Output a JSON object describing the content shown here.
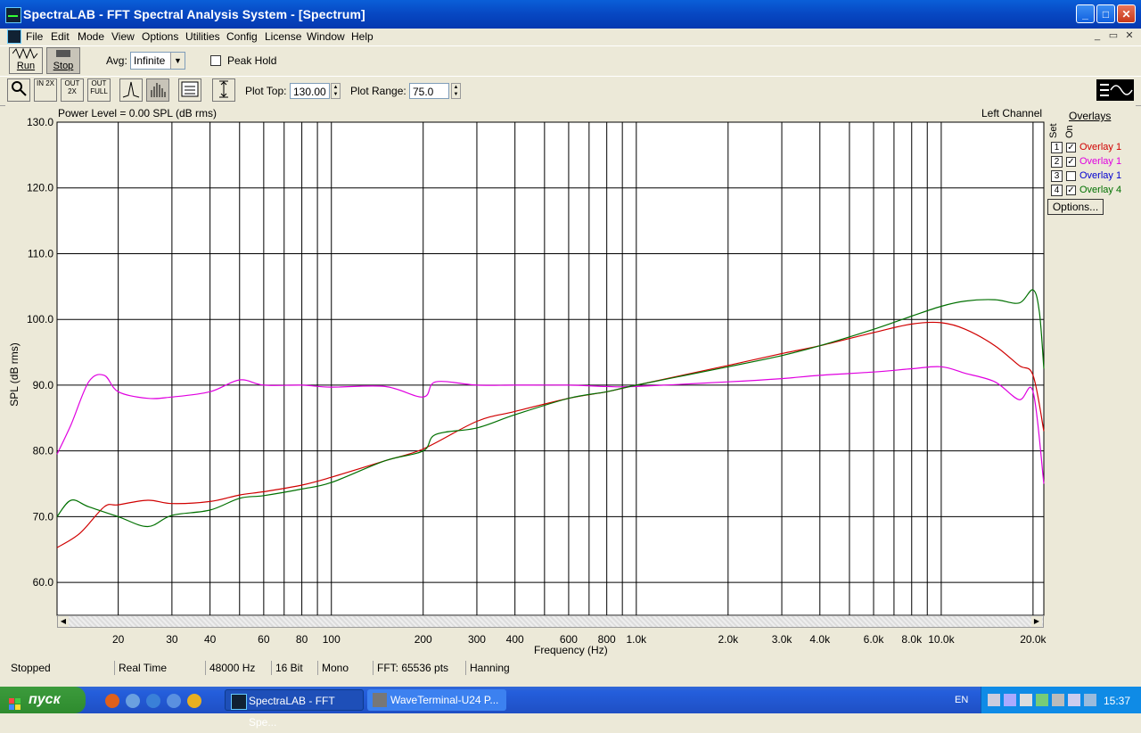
{
  "window": {
    "title": "SpectraLAB - FFT Spectral Analysis System - [Spectrum]",
    "min": "_",
    "max": "□",
    "close": "✕"
  },
  "menu": [
    "File",
    "Edit",
    "Mode",
    "View",
    "Options",
    "Utilities",
    "Config",
    "License",
    "Window",
    "Help"
  ],
  "mdi": {
    "min": "_",
    "restore": "▭",
    "close": "✕"
  },
  "toolbar1": {
    "run": "Run",
    "stop": "Stop",
    "avg_label": "Avg:",
    "avg_value": "Infinite",
    "peak_hold": "Peak Hold"
  },
  "toolbar2": {
    "zoom_in": "IN 2X",
    "zoom_out": "OUT 2X",
    "zoom_full": "OUT FULL",
    "plot_top_label": "Plot Top:",
    "plot_top_value": "130.00",
    "plot_range_label": "Plot Range:",
    "plot_range_value": "75.0"
  },
  "plot": {
    "power_level": "Power Level = 0.00 SPL (dB rms)",
    "channel": "Left Channel"
  },
  "overlays": {
    "title": "Overlays",
    "col_set": "Set",
    "col_on": "On",
    "rows": [
      {
        "num": "1",
        "checked": "✓",
        "label": "Overlay 1",
        "color": "#D00000"
      },
      {
        "num": "2",
        "checked": "✓",
        "label": "Overlay 1",
        "color": "#E000E0"
      },
      {
        "num": "3",
        "checked": "",
        "label": "Overlay 1",
        "color": "#0000D0"
      },
      {
        "num": "4",
        "checked": "✓",
        "label": "Overlay 4",
        "color": "#007000"
      }
    ],
    "options": "Options..."
  },
  "status": [
    "Stopped",
    "Real Time",
    "48000 Hz",
    "16 Bit",
    "Mono",
    "FFT: 65536 pts",
    "Hanning"
  ],
  "taskbar": {
    "start": "пуск",
    "tasks": [
      "SpectraLAB - FFT Spe...",
      "WaveTerminal-U24 P..."
    ],
    "lang": "EN",
    "clock": "15:37"
  },
  "chart_data": {
    "type": "line",
    "xlabel": "Frequency (Hz)",
    "ylabel": "SPL (dB rms)",
    "xscale": "log",
    "xlim": [
      12.6,
      21700
    ],
    "ylim": [
      55,
      130
    ],
    "yticks": [
      "130.0",
      "120.0",
      "110.0",
      "100.0",
      "90.0",
      "80.0",
      "70.0",
      "60.0"
    ],
    "xticks": [
      {
        "f": 20,
        "label": "20"
      },
      {
        "f": 30,
        "label": "30"
      },
      {
        "f": 40,
        "label": "40"
      },
      {
        "f": 60,
        "label": "60"
      },
      {
        "f": 80,
        "label": "80"
      },
      {
        "f": 100,
        "label": "100"
      },
      {
        "f": 200,
        "label": "200"
      },
      {
        "f": 300,
        "label": "300"
      },
      {
        "f": 400,
        "label": "400"
      },
      {
        "f": 600,
        "label": "600"
      },
      {
        "f": 800,
        "label": "800"
      },
      {
        "f": 1000,
        "label": "1.0k"
      },
      {
        "f": 2000,
        "label": "2.0k"
      },
      {
        "f": 3000,
        "label": "3.0k"
      },
      {
        "f": 4000,
        "label": "4.0k"
      },
      {
        "f": 6000,
        "label": "6.0k"
      },
      {
        "f": 8000,
        "label": "8.0k"
      },
      {
        "f": 10000,
        "label": "10.0k"
      },
      {
        "f": 20000,
        "label": "20.0k"
      }
    ],
    "grid": true,
    "series": [
      {
        "name": "Overlay 1",
        "color": "#D00000",
        "x": [
          12.6,
          15,
          18,
          20,
          25,
          30,
          40,
          50,
          60,
          80,
          100,
          150,
          200,
          300,
          400,
          600,
          800,
          1000,
          2000,
          3000,
          4000,
          6000,
          8000,
          10000,
          12000,
          15000,
          18000,
          20000,
          21700
        ],
        "y": [
          65.3,
          67.5,
          71.5,
          71.8,
          72.5,
          72.0,
          72.3,
          73.3,
          73.8,
          74.8,
          76.0,
          78.5,
          80.3,
          84.5,
          86.0,
          88.0,
          89.0,
          90.0,
          93.0,
          94.8,
          96.0,
          98.0,
          99.3,
          99.5,
          98.5,
          96.0,
          93.0,
          91.5,
          83.0
        ]
      },
      {
        "name": "Overlay 1",
        "color": "#E000E0",
        "x": [
          12.6,
          14,
          16,
          18,
          20,
          25,
          30,
          40,
          50,
          60,
          80,
          100,
          150,
          200,
          220,
          300,
          400,
          600,
          800,
          1000,
          2000,
          3000,
          4000,
          6000,
          8000,
          10000,
          12000,
          15000,
          18000,
          20000,
          21700
        ],
        "y": [
          79.5,
          84.0,
          90.5,
          91.5,
          89.0,
          88.0,
          88.2,
          89.0,
          90.8,
          90.0,
          90.0,
          89.7,
          89.8,
          88.2,
          90.5,
          90.0,
          90.0,
          90.0,
          89.8,
          89.8,
          90.5,
          91.0,
          91.5,
          92.0,
          92.5,
          92.8,
          91.8,
          90.5,
          87.8,
          89.0,
          75.0
        ]
      },
      {
        "name": "Overlay 4",
        "color": "#007000",
        "x": [
          12.6,
          14,
          16,
          20,
          25,
          30,
          40,
          50,
          60,
          80,
          100,
          150,
          200,
          220,
          300,
          400,
          600,
          800,
          1000,
          2000,
          3000,
          4000,
          6000,
          8000,
          10000,
          12000,
          15000,
          18000,
          20000,
          21000,
          21700
        ],
        "y": [
          70.0,
          72.5,
          71.5,
          70.0,
          68.5,
          70.2,
          71.0,
          72.8,
          73.2,
          74.2,
          75.2,
          78.5,
          80.0,
          82.5,
          83.5,
          85.5,
          88.0,
          89.0,
          90.0,
          92.8,
          94.5,
          96.0,
          98.5,
          100.5,
          102.0,
          102.8,
          103.0,
          102.5,
          104.5,
          101.0,
          92.5
        ]
      }
    ]
  }
}
